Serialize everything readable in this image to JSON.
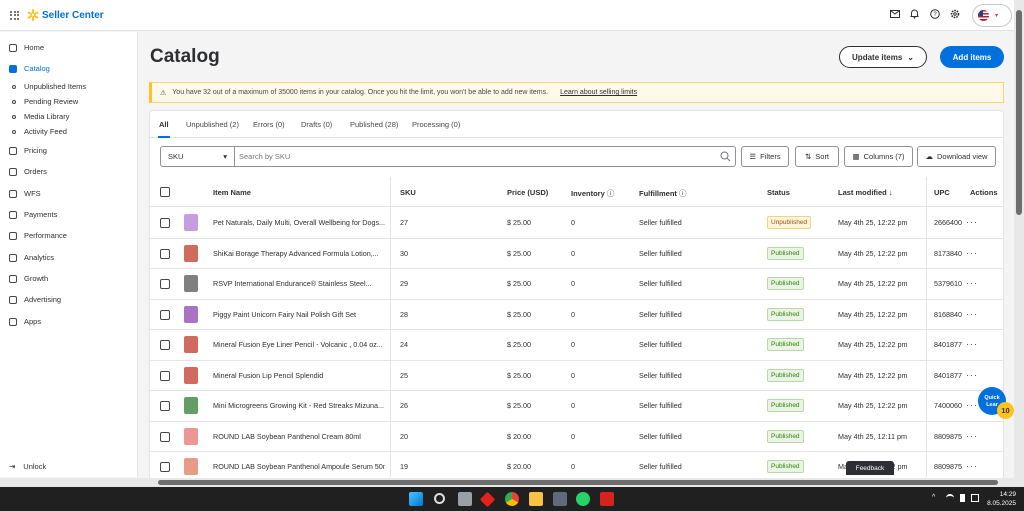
{
  "app": {
    "brand": "Seller Center"
  },
  "sidebar": {
    "items": [
      {
        "label": "Home",
        "icon": "home-icon"
      },
      {
        "label": "Catalog",
        "icon": "catalog-icon",
        "active": true
      },
      {
        "label": "Pricing",
        "icon": "tag-icon"
      },
      {
        "label": "Orders",
        "icon": "orders-icon"
      },
      {
        "label": "WFS",
        "icon": "truck-icon"
      },
      {
        "label": "Payments",
        "icon": "payments-icon"
      },
      {
        "label": "Performance",
        "icon": "performance-icon"
      },
      {
        "label": "Analytics",
        "icon": "analytics-icon"
      },
      {
        "label": "Growth",
        "icon": "growth-icon"
      },
      {
        "label": "Advertising",
        "icon": "advertising-icon"
      },
      {
        "label": "Apps",
        "icon": "apps-icon"
      }
    ],
    "catalog_sub": [
      "Unpublished Items",
      "Pending Review",
      "Media Library",
      "Activity Feed"
    ],
    "unlock": "Unlock"
  },
  "page": {
    "title": "Catalog",
    "update_items": "Update items",
    "add_items": "Add items"
  },
  "alert": {
    "message": "You have 32 out of a maximum of 35000 items in your catalog. Once you hit the limit, you won't be able to add new items.",
    "link": "Learn about selling limits"
  },
  "tabs": [
    "All",
    "Unpublished (2)",
    "Errors (0)",
    "Drafts (0)",
    "Published (28)",
    "Processing (0)"
  ],
  "toolbar": {
    "search_type": "SKU",
    "search_placeholder": "Search by SKU",
    "filters": "Filters",
    "sort": "Sort",
    "columns": "Columns (7)",
    "download": "Download view"
  },
  "table": {
    "headers": {
      "item_name": "Item Name",
      "sku": "SKU",
      "price": "Price (USD)",
      "inventory": "Inventory",
      "fulfillment": "Fulfillment",
      "status": "Status",
      "last_modified": "Last modified ↓",
      "upc": "UPC",
      "actions": "Actions"
    },
    "rows": [
      {
        "name": "Pet Naturals, Daily Multi, Overall Wellbeing for Dogs...",
        "sku": "27",
        "price": "$ 25.00",
        "inventory": "0",
        "fulfillment": "Seller fulfilled",
        "status": "Unpublished",
        "modified": "May 4th 25, 12:22 pm",
        "upc": "2666400"
      },
      {
        "name": "ShiKai Borage Therapy Advanced Formula Lotion,...",
        "sku": "30",
        "price": "$ 25.00",
        "inventory": "0",
        "fulfillment": "Seller fulfilled",
        "status": "Published",
        "modified": "May 4th 25, 12:22 pm",
        "upc": "8173840"
      },
      {
        "name": "RSVP International Endurance® Stainless Steel...",
        "sku": "29",
        "price": "$ 25.00",
        "inventory": "0",
        "fulfillment": "Seller fulfilled",
        "status": "Published",
        "modified": "May 4th 25, 12:22 pm",
        "upc": "5379610"
      },
      {
        "name": "Piggy Paint Unicorn Fairy Nail Polish Gift Set",
        "sku": "28",
        "price": "$ 25.00",
        "inventory": "0",
        "fulfillment": "Seller fulfilled",
        "status": "Published",
        "modified": "May 4th 25, 12:22 pm",
        "upc": "8168840"
      },
      {
        "name": "Mineral Fusion Eye Liner Pencil - Volcanic , 0.04 oz...",
        "sku": "24",
        "price": "$ 25.00",
        "inventory": "0",
        "fulfillment": "Seller fulfilled",
        "status": "Published",
        "modified": "May 4th 25, 12:22 pm",
        "upc": "8401877"
      },
      {
        "name": "Mineral Fusion Lip Pencil Splendid",
        "sku": "25",
        "price": "$ 25.00",
        "inventory": "0",
        "fulfillment": "Seller fulfilled",
        "status": "Published",
        "modified": "May 4th 25, 12:22 pm",
        "upc": "8401877"
      },
      {
        "name": "Mini Microgreens Growing Kit - Red Streaks Mizuna...",
        "sku": "26",
        "price": "$ 25.00",
        "inventory": "0",
        "fulfillment": "Seller fulfilled",
        "status": "Published",
        "modified": "May 4th 25, 12:22 pm",
        "upc": "7400060"
      },
      {
        "name": "ROUND LAB Soybean Panthenol Cream 80ml",
        "sku": "20",
        "price": "$ 20.00",
        "inventory": "0",
        "fulfillment": "Seller fulfilled",
        "status": "Published",
        "modified": "May 4th 25, 12:11 pm",
        "upc": "8809875"
      },
      {
        "name": "ROUND LAB Soybean Panthenol Ampoule Serum 50ml",
        "sku": "19",
        "price": "$ 20.00",
        "inventory": "0",
        "fulfillment": "Seller fulfilled",
        "status": "Published",
        "modified": "May 4th 25, 12:22 pm",
        "upc": "8809875"
      }
    ]
  },
  "quick_learn": {
    "label": "Quick Lear",
    "count": "10"
  },
  "feedback": "Feedback",
  "taskbar": {
    "time": "14:29",
    "date": "8.05.2025"
  },
  "colors": {
    "accent": "#0071dc",
    "spark": "#ffc220",
    "published": "#2a8703",
    "unpublished": "#995213"
  }
}
